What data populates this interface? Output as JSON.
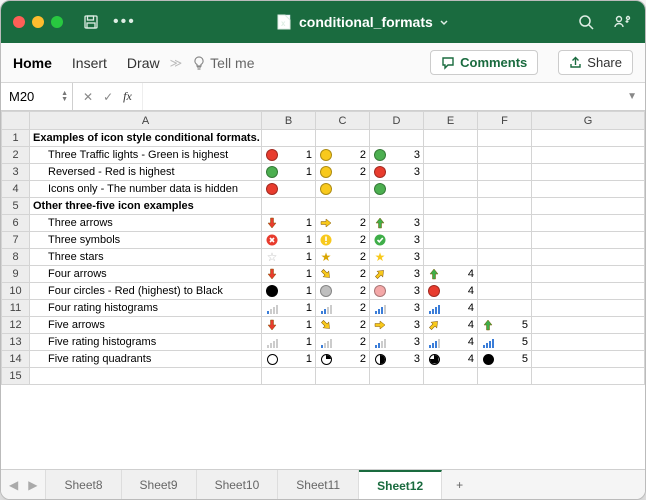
{
  "title": "conditional_formats",
  "ribbon": {
    "home": "Home",
    "insert": "Insert",
    "draw": "Draw",
    "tellme": "Tell me",
    "comments": "Comments",
    "share": "Share"
  },
  "namebox": "M20",
  "columns": [
    "A",
    "B",
    "C",
    "D",
    "E",
    "F",
    "G"
  ],
  "rows": [
    {
      "n": 1,
      "bold": true,
      "label": "Examples of icon style conditional formats."
    },
    {
      "n": 2,
      "indent": true,
      "label": "Three Traffic lights - Green is highest",
      "cells": [
        {
          "icon": "circle-red",
          "v": "1"
        },
        {
          "icon": "circle-yellow",
          "v": "2"
        },
        {
          "icon": "circle-green",
          "v": "3"
        }
      ]
    },
    {
      "n": 3,
      "indent": true,
      "label": "Reversed - Red is highest",
      "cells": [
        {
          "icon": "circle-green",
          "v": "1"
        },
        {
          "icon": "circle-yellow",
          "v": "2"
        },
        {
          "icon": "circle-red",
          "v": "3"
        }
      ]
    },
    {
      "n": 4,
      "indent": true,
      "label": "Icons only - The number data is hidden",
      "cells": [
        {
          "icon": "circle-red",
          "v": ""
        },
        {
          "icon": "circle-yellow",
          "v": ""
        },
        {
          "icon": "circle-green",
          "v": ""
        }
      ]
    },
    {
      "n": 5,
      "bold": true,
      "label": "Other three-five icon examples"
    },
    {
      "n": 6,
      "indent": true,
      "label": "Three arrows",
      "cells": [
        {
          "icon": "arrow-down-red",
          "v": "1"
        },
        {
          "icon": "arrow-right-yellow",
          "v": "2"
        },
        {
          "icon": "arrow-up-green",
          "v": "3"
        }
      ]
    },
    {
      "n": 7,
      "indent": true,
      "label": "Three symbols",
      "cells": [
        {
          "icon": "sym-cross",
          "v": "1"
        },
        {
          "icon": "sym-excl",
          "v": "2"
        },
        {
          "icon": "sym-check",
          "v": "3"
        }
      ]
    },
    {
      "n": 8,
      "indent": true,
      "label": "Three stars",
      "cells": [
        {
          "icon": "star-empty",
          "v": "1"
        },
        {
          "icon": "star-half",
          "v": "2"
        },
        {
          "icon": "star-full",
          "v": "3"
        }
      ]
    },
    {
      "n": 9,
      "indent": true,
      "label": "Four arrows",
      "cells": [
        {
          "icon": "arrow-down-red",
          "v": "1"
        },
        {
          "icon": "arrow-dr-yellow",
          "v": "2"
        },
        {
          "icon": "arrow-ur-yellow",
          "v": "3"
        },
        {
          "icon": "arrow-up-green",
          "v": "4"
        }
      ]
    },
    {
      "n": 10,
      "indent": true,
      "label": "Four circles - Red (highest) to Black",
      "cells": [
        {
          "icon": "circle-black",
          "v": "1"
        },
        {
          "icon": "circle-grey",
          "v": "2"
        },
        {
          "icon": "circle-pink",
          "v": "3"
        },
        {
          "icon": "circle-red",
          "v": "4"
        }
      ]
    },
    {
      "n": 11,
      "indent": true,
      "label": "Four rating histograms",
      "cells": [
        {
          "icon": "bars-1",
          "v": "1"
        },
        {
          "icon": "bars-2",
          "v": "2"
        },
        {
          "icon": "bars-3",
          "v": "3"
        },
        {
          "icon": "bars-4",
          "v": "4"
        }
      ]
    },
    {
      "n": 12,
      "indent": true,
      "label": "Five arrows",
      "cells": [
        {
          "icon": "arrow-down-red",
          "v": "1"
        },
        {
          "icon": "arrow-dr-yellow",
          "v": "2"
        },
        {
          "icon": "arrow-right-yellow",
          "v": "3"
        },
        {
          "icon": "arrow-ur-yellow",
          "v": "4"
        },
        {
          "icon": "arrow-up-green",
          "v": "5"
        }
      ]
    },
    {
      "n": 13,
      "indent": true,
      "label": "Five rating histograms",
      "cells": [
        {
          "icon": "bars-0",
          "v": "1"
        },
        {
          "icon": "bars-1",
          "v": "2"
        },
        {
          "icon": "bars-2",
          "v": "3"
        },
        {
          "icon": "bars-3",
          "v": "4"
        },
        {
          "icon": "bars-4",
          "v": "5"
        }
      ]
    },
    {
      "n": 14,
      "indent": true,
      "label": "Five rating quadrants",
      "cells": [
        {
          "icon": "quad-0",
          "v": "1"
        },
        {
          "icon": "quad-1",
          "v": "2"
        },
        {
          "icon": "quad-2",
          "v": "3"
        },
        {
          "icon": "quad-3",
          "v": "4"
        },
        {
          "icon": "quad-4",
          "v": "5"
        }
      ]
    },
    {
      "n": 15
    }
  ],
  "sheets": [
    "Sheet8",
    "Sheet9",
    "Sheet10",
    "Sheet11",
    "Sheet12"
  ],
  "activeSheet": "Sheet12"
}
